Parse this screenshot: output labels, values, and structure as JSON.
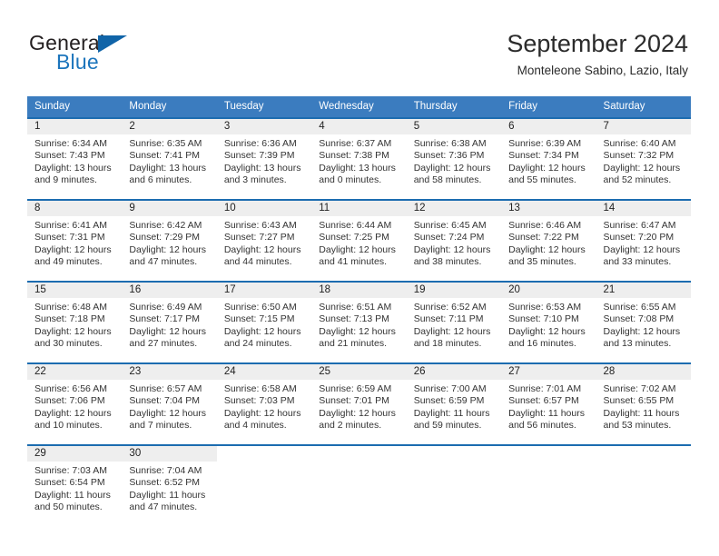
{
  "brand": {
    "name_top": "General",
    "name_bottom": "Blue",
    "accent_color": "#1c75bc",
    "flag_color": "#1064a8"
  },
  "header": {
    "title": "September 2024",
    "subtitle": "Monteleone Sabino, Lazio, Italy"
  },
  "calendar": {
    "header_bg": "#3b7cbf",
    "row_border_color": "#1c6cb0",
    "daynum_bg": "#eeeeee",
    "weekdays": [
      "Sunday",
      "Monday",
      "Tuesday",
      "Wednesday",
      "Thursday",
      "Friday",
      "Saturday"
    ],
    "weeks": [
      [
        {
          "day": "1",
          "sunrise": "Sunrise: 6:34 AM",
          "sunset": "Sunset: 7:43 PM",
          "daylight": "Daylight: 13 hours and 9 minutes."
        },
        {
          "day": "2",
          "sunrise": "Sunrise: 6:35 AM",
          "sunset": "Sunset: 7:41 PM",
          "daylight": "Daylight: 13 hours and 6 minutes."
        },
        {
          "day": "3",
          "sunrise": "Sunrise: 6:36 AM",
          "sunset": "Sunset: 7:39 PM",
          "daylight": "Daylight: 13 hours and 3 minutes."
        },
        {
          "day": "4",
          "sunrise": "Sunrise: 6:37 AM",
          "sunset": "Sunset: 7:38 PM",
          "daylight": "Daylight: 13 hours and 0 minutes."
        },
        {
          "day": "5",
          "sunrise": "Sunrise: 6:38 AM",
          "sunset": "Sunset: 7:36 PM",
          "daylight": "Daylight: 12 hours and 58 minutes."
        },
        {
          "day": "6",
          "sunrise": "Sunrise: 6:39 AM",
          "sunset": "Sunset: 7:34 PM",
          "daylight": "Daylight: 12 hours and 55 minutes."
        },
        {
          "day": "7",
          "sunrise": "Sunrise: 6:40 AM",
          "sunset": "Sunset: 7:32 PM",
          "daylight": "Daylight: 12 hours and 52 minutes."
        }
      ],
      [
        {
          "day": "8",
          "sunrise": "Sunrise: 6:41 AM",
          "sunset": "Sunset: 7:31 PM",
          "daylight": "Daylight: 12 hours and 49 minutes."
        },
        {
          "day": "9",
          "sunrise": "Sunrise: 6:42 AM",
          "sunset": "Sunset: 7:29 PM",
          "daylight": "Daylight: 12 hours and 47 minutes."
        },
        {
          "day": "10",
          "sunrise": "Sunrise: 6:43 AM",
          "sunset": "Sunset: 7:27 PM",
          "daylight": "Daylight: 12 hours and 44 minutes."
        },
        {
          "day": "11",
          "sunrise": "Sunrise: 6:44 AM",
          "sunset": "Sunset: 7:25 PM",
          "daylight": "Daylight: 12 hours and 41 minutes."
        },
        {
          "day": "12",
          "sunrise": "Sunrise: 6:45 AM",
          "sunset": "Sunset: 7:24 PM",
          "daylight": "Daylight: 12 hours and 38 minutes."
        },
        {
          "day": "13",
          "sunrise": "Sunrise: 6:46 AM",
          "sunset": "Sunset: 7:22 PM",
          "daylight": "Daylight: 12 hours and 35 minutes."
        },
        {
          "day": "14",
          "sunrise": "Sunrise: 6:47 AM",
          "sunset": "Sunset: 7:20 PM",
          "daylight": "Daylight: 12 hours and 33 minutes."
        }
      ],
      [
        {
          "day": "15",
          "sunrise": "Sunrise: 6:48 AM",
          "sunset": "Sunset: 7:18 PM",
          "daylight": "Daylight: 12 hours and 30 minutes."
        },
        {
          "day": "16",
          "sunrise": "Sunrise: 6:49 AM",
          "sunset": "Sunset: 7:17 PM",
          "daylight": "Daylight: 12 hours and 27 minutes."
        },
        {
          "day": "17",
          "sunrise": "Sunrise: 6:50 AM",
          "sunset": "Sunset: 7:15 PM",
          "daylight": "Daylight: 12 hours and 24 minutes."
        },
        {
          "day": "18",
          "sunrise": "Sunrise: 6:51 AM",
          "sunset": "Sunset: 7:13 PM",
          "daylight": "Daylight: 12 hours and 21 minutes."
        },
        {
          "day": "19",
          "sunrise": "Sunrise: 6:52 AM",
          "sunset": "Sunset: 7:11 PM",
          "daylight": "Daylight: 12 hours and 18 minutes."
        },
        {
          "day": "20",
          "sunrise": "Sunrise: 6:53 AM",
          "sunset": "Sunset: 7:10 PM",
          "daylight": "Daylight: 12 hours and 16 minutes."
        },
        {
          "day": "21",
          "sunrise": "Sunrise: 6:55 AM",
          "sunset": "Sunset: 7:08 PM",
          "daylight": "Daylight: 12 hours and 13 minutes."
        }
      ],
      [
        {
          "day": "22",
          "sunrise": "Sunrise: 6:56 AM",
          "sunset": "Sunset: 7:06 PM",
          "daylight": "Daylight: 12 hours and 10 minutes."
        },
        {
          "day": "23",
          "sunrise": "Sunrise: 6:57 AM",
          "sunset": "Sunset: 7:04 PM",
          "daylight": "Daylight: 12 hours and 7 minutes."
        },
        {
          "day": "24",
          "sunrise": "Sunrise: 6:58 AM",
          "sunset": "Sunset: 7:03 PM",
          "daylight": "Daylight: 12 hours and 4 minutes."
        },
        {
          "day": "25",
          "sunrise": "Sunrise: 6:59 AM",
          "sunset": "Sunset: 7:01 PM",
          "daylight": "Daylight: 12 hours and 2 minutes."
        },
        {
          "day": "26",
          "sunrise": "Sunrise: 7:00 AM",
          "sunset": "Sunset: 6:59 PM",
          "daylight": "Daylight: 11 hours and 59 minutes."
        },
        {
          "day": "27",
          "sunrise": "Sunrise: 7:01 AM",
          "sunset": "Sunset: 6:57 PM",
          "daylight": "Daylight: 11 hours and 56 minutes."
        },
        {
          "day": "28",
          "sunrise": "Sunrise: 7:02 AM",
          "sunset": "Sunset: 6:55 PM",
          "daylight": "Daylight: 11 hours and 53 minutes."
        }
      ],
      [
        {
          "day": "29",
          "sunrise": "Sunrise: 7:03 AM",
          "sunset": "Sunset: 6:54 PM",
          "daylight": "Daylight: 11 hours and 50 minutes."
        },
        {
          "day": "30",
          "sunrise": "Sunrise: 7:04 AM",
          "sunset": "Sunset: 6:52 PM",
          "daylight": "Daylight: 11 hours and 47 minutes."
        },
        {
          "day": "",
          "sunrise": "",
          "sunset": "",
          "daylight": ""
        },
        {
          "day": "",
          "sunrise": "",
          "sunset": "",
          "daylight": ""
        },
        {
          "day": "",
          "sunrise": "",
          "sunset": "",
          "daylight": ""
        },
        {
          "day": "",
          "sunrise": "",
          "sunset": "",
          "daylight": ""
        },
        {
          "day": "",
          "sunrise": "",
          "sunset": "",
          "daylight": ""
        }
      ]
    ]
  }
}
